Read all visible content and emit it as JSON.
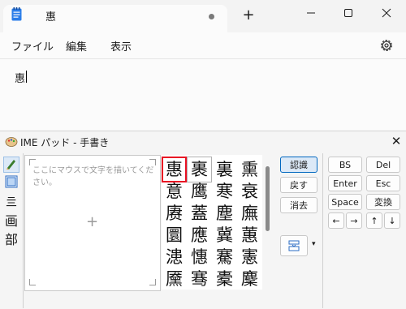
{
  "notepad": {
    "tab_title": "惠",
    "menu": [
      "ファイル",
      "編集",
      "表示"
    ],
    "editor_text": "惠"
  },
  "ime": {
    "title": "IME パッド - 手書き",
    "draw_hint": "ここにマウスで文字を描いてください。",
    "candidates": [
      "惠",
      "裹",
      "裏",
      "熏",
      "意",
      "鹰",
      "寒",
      "衰",
      "赓",
      "蓋",
      "塵",
      "廡",
      "圜",
      "應",
      "冀",
      "蕙",
      "漶",
      "憓",
      "騫",
      "憲",
      "黡",
      "骞",
      "橐",
      "麇"
    ],
    "action_buttons": [
      "認識",
      "戻す",
      "消去"
    ],
    "keys": [
      "BS",
      "Del",
      "Enter",
      "Esc",
      "Space",
      "変換",
      "←",
      "→",
      "↑",
      "↓"
    ]
  },
  "colors": {
    "selection": "#e81123",
    "accent_border": "#0067c0"
  }
}
